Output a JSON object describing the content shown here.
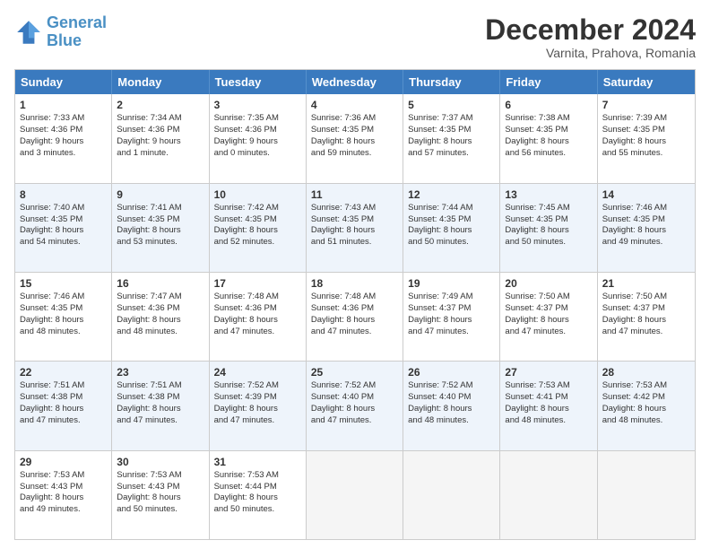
{
  "header": {
    "logo_general": "General",
    "logo_blue": "Blue",
    "month_title": "December 2024",
    "location": "Varnita, Prahova, Romania"
  },
  "weekdays": [
    "Sunday",
    "Monday",
    "Tuesday",
    "Wednesday",
    "Thursday",
    "Friday",
    "Saturday"
  ],
  "rows": [
    [
      {
        "day": "1",
        "lines": [
          "Sunrise: 7:33 AM",
          "Sunset: 4:36 PM",
          "Daylight: 9 hours",
          "and 3 minutes."
        ]
      },
      {
        "day": "2",
        "lines": [
          "Sunrise: 7:34 AM",
          "Sunset: 4:36 PM",
          "Daylight: 9 hours",
          "and 1 minute."
        ]
      },
      {
        "day": "3",
        "lines": [
          "Sunrise: 7:35 AM",
          "Sunset: 4:36 PM",
          "Daylight: 9 hours",
          "and 0 minutes."
        ]
      },
      {
        "day": "4",
        "lines": [
          "Sunrise: 7:36 AM",
          "Sunset: 4:35 PM",
          "Daylight: 8 hours",
          "and 59 minutes."
        ]
      },
      {
        "day": "5",
        "lines": [
          "Sunrise: 7:37 AM",
          "Sunset: 4:35 PM",
          "Daylight: 8 hours",
          "and 57 minutes."
        ]
      },
      {
        "day": "6",
        "lines": [
          "Sunrise: 7:38 AM",
          "Sunset: 4:35 PM",
          "Daylight: 8 hours",
          "and 56 minutes."
        ]
      },
      {
        "day": "7",
        "lines": [
          "Sunrise: 7:39 AM",
          "Sunset: 4:35 PM",
          "Daylight: 8 hours",
          "and 55 minutes."
        ]
      }
    ],
    [
      {
        "day": "8",
        "lines": [
          "Sunrise: 7:40 AM",
          "Sunset: 4:35 PM",
          "Daylight: 8 hours",
          "and 54 minutes."
        ]
      },
      {
        "day": "9",
        "lines": [
          "Sunrise: 7:41 AM",
          "Sunset: 4:35 PM",
          "Daylight: 8 hours",
          "and 53 minutes."
        ]
      },
      {
        "day": "10",
        "lines": [
          "Sunrise: 7:42 AM",
          "Sunset: 4:35 PM",
          "Daylight: 8 hours",
          "and 52 minutes."
        ]
      },
      {
        "day": "11",
        "lines": [
          "Sunrise: 7:43 AM",
          "Sunset: 4:35 PM",
          "Daylight: 8 hours",
          "and 51 minutes."
        ]
      },
      {
        "day": "12",
        "lines": [
          "Sunrise: 7:44 AM",
          "Sunset: 4:35 PM",
          "Daylight: 8 hours",
          "and 50 minutes."
        ]
      },
      {
        "day": "13",
        "lines": [
          "Sunrise: 7:45 AM",
          "Sunset: 4:35 PM",
          "Daylight: 8 hours",
          "and 50 minutes."
        ]
      },
      {
        "day": "14",
        "lines": [
          "Sunrise: 7:46 AM",
          "Sunset: 4:35 PM",
          "Daylight: 8 hours",
          "and 49 minutes."
        ]
      }
    ],
    [
      {
        "day": "15",
        "lines": [
          "Sunrise: 7:46 AM",
          "Sunset: 4:35 PM",
          "Daylight: 8 hours",
          "and 48 minutes."
        ]
      },
      {
        "day": "16",
        "lines": [
          "Sunrise: 7:47 AM",
          "Sunset: 4:36 PM",
          "Daylight: 8 hours",
          "and 48 minutes."
        ]
      },
      {
        "day": "17",
        "lines": [
          "Sunrise: 7:48 AM",
          "Sunset: 4:36 PM",
          "Daylight: 8 hours",
          "and 47 minutes."
        ]
      },
      {
        "day": "18",
        "lines": [
          "Sunrise: 7:48 AM",
          "Sunset: 4:36 PM",
          "Daylight: 8 hours",
          "and 47 minutes."
        ]
      },
      {
        "day": "19",
        "lines": [
          "Sunrise: 7:49 AM",
          "Sunset: 4:37 PM",
          "Daylight: 8 hours",
          "and 47 minutes."
        ]
      },
      {
        "day": "20",
        "lines": [
          "Sunrise: 7:50 AM",
          "Sunset: 4:37 PM",
          "Daylight: 8 hours",
          "and 47 minutes."
        ]
      },
      {
        "day": "21",
        "lines": [
          "Sunrise: 7:50 AM",
          "Sunset: 4:37 PM",
          "Daylight: 8 hours",
          "and 47 minutes."
        ]
      }
    ],
    [
      {
        "day": "22",
        "lines": [
          "Sunrise: 7:51 AM",
          "Sunset: 4:38 PM",
          "Daylight: 8 hours",
          "and 47 minutes."
        ]
      },
      {
        "day": "23",
        "lines": [
          "Sunrise: 7:51 AM",
          "Sunset: 4:38 PM",
          "Daylight: 8 hours",
          "and 47 minutes."
        ]
      },
      {
        "day": "24",
        "lines": [
          "Sunrise: 7:52 AM",
          "Sunset: 4:39 PM",
          "Daylight: 8 hours",
          "and 47 minutes."
        ]
      },
      {
        "day": "25",
        "lines": [
          "Sunrise: 7:52 AM",
          "Sunset: 4:40 PM",
          "Daylight: 8 hours",
          "and 47 minutes."
        ]
      },
      {
        "day": "26",
        "lines": [
          "Sunrise: 7:52 AM",
          "Sunset: 4:40 PM",
          "Daylight: 8 hours",
          "and 48 minutes."
        ]
      },
      {
        "day": "27",
        "lines": [
          "Sunrise: 7:53 AM",
          "Sunset: 4:41 PM",
          "Daylight: 8 hours",
          "and 48 minutes."
        ]
      },
      {
        "day": "28",
        "lines": [
          "Sunrise: 7:53 AM",
          "Sunset: 4:42 PM",
          "Daylight: 8 hours",
          "and 48 minutes."
        ]
      }
    ],
    [
      {
        "day": "29",
        "lines": [
          "Sunrise: 7:53 AM",
          "Sunset: 4:43 PM",
          "Daylight: 8 hours",
          "and 49 minutes."
        ]
      },
      {
        "day": "30",
        "lines": [
          "Sunrise: 7:53 AM",
          "Sunset: 4:43 PM",
          "Daylight: 8 hours",
          "and 50 minutes."
        ]
      },
      {
        "day": "31",
        "lines": [
          "Sunrise: 7:53 AM",
          "Sunset: 4:44 PM",
          "Daylight: 8 hours",
          "and 50 minutes."
        ]
      },
      null,
      null,
      null,
      null
    ]
  ]
}
